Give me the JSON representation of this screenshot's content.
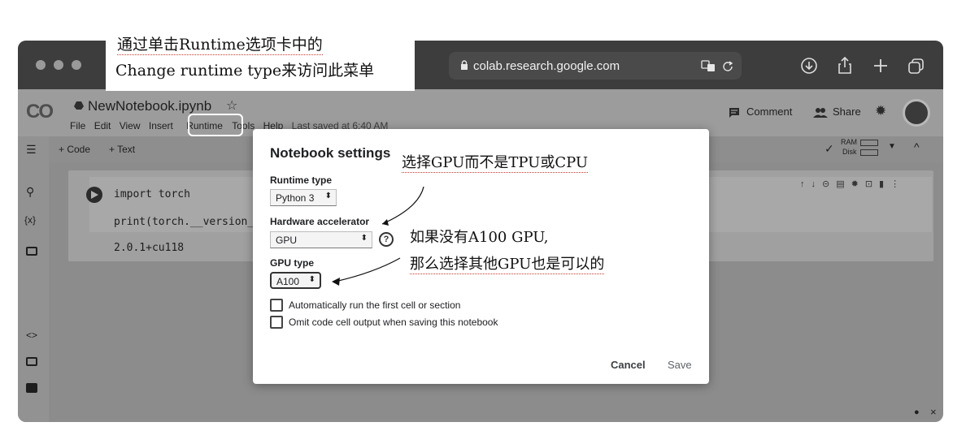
{
  "annotations": {
    "top_line1": "通过单击Runtime选项卡中的",
    "top_line2": "Change runtime type来访问此菜单",
    "gpu_note": "选择GPU而不是TPU或CPU",
    "a100_line1": "如果没有A100 GPU,",
    "a100_line2": "那么选择其他GPU也是可以的"
  },
  "browser": {
    "url": "colab.research.google.com"
  },
  "colab": {
    "logo": "CO",
    "notebook_title": "NewNotebook.ipynb",
    "menu": [
      "File",
      "Edit",
      "View",
      "Insert",
      "Runtime",
      "Tools",
      "Help"
    ],
    "last_saved": "Last saved at 6:40 AM",
    "comment_label": "Comment",
    "share_label": "Share",
    "add_code": "+ Code",
    "add_text": "+ Text",
    "ram_label": "RAM",
    "disk_label": "Disk"
  },
  "cell": {
    "code_line1": "import torch",
    "code_line2": "print(torch.__version__)",
    "output": "2.0.1+cu118"
  },
  "modal": {
    "title": "Notebook settings",
    "runtime_type_label": "Runtime type",
    "runtime_type_value": "Python 3",
    "hardware_label": "Hardware accelerator",
    "hardware_value": "GPU",
    "gpu_type_label": "GPU type",
    "gpu_type_value": "A100",
    "checkbox1": "Automatically run the first cell or section",
    "checkbox2": "Omit code cell output when saving this notebook",
    "cancel": "Cancel",
    "save": "Save"
  },
  "colors": {
    "titlebar": "#3d3d3d",
    "dim_overlay": "#8c8c8c",
    "modal_bg": "#ffffff"
  }
}
